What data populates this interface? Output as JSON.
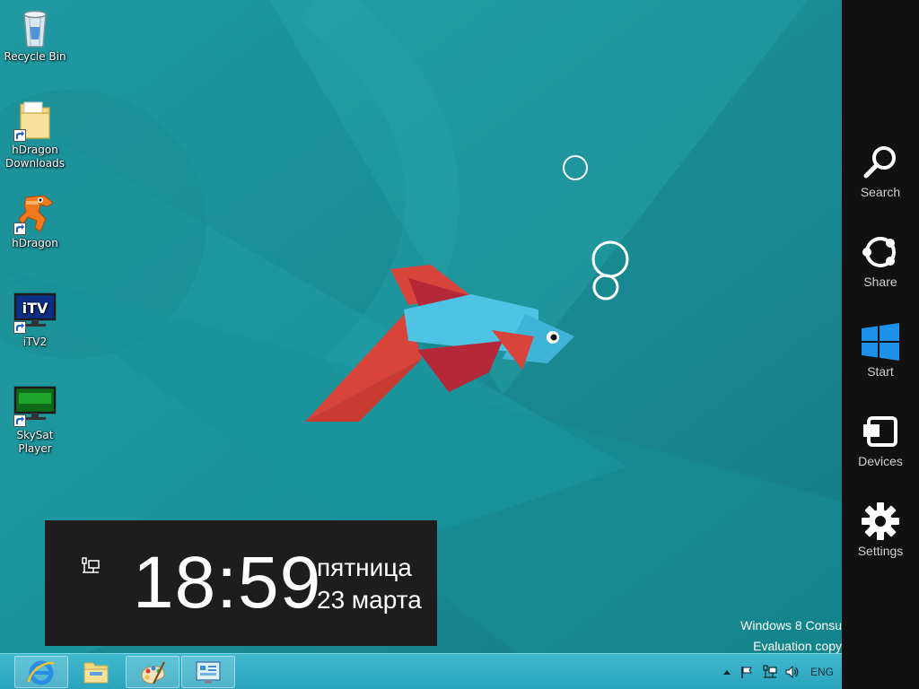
{
  "desktop": {
    "icons": [
      {
        "label": "Recycle Bin",
        "icon": "recycle-bin-icon"
      },
      {
        "label": "hDragon Downloads",
        "icon": "folder-icon"
      },
      {
        "label": "hDragon",
        "icon": "hdragon-icon"
      },
      {
        "label": "iTV2",
        "icon": "itv-icon",
        "badge": "iTV"
      },
      {
        "label": "SkySat Player",
        "icon": "skysat-icon"
      }
    ]
  },
  "charms": [
    {
      "label": "Search",
      "icon": "search-icon"
    },
    {
      "label": "Share",
      "icon": "share-icon"
    },
    {
      "label": "Start",
      "icon": "windows-logo-icon"
    },
    {
      "label": "Devices",
      "icon": "devices-icon"
    },
    {
      "label": "Settings",
      "icon": "gear-icon"
    }
  ],
  "clock": {
    "time": "18:59",
    "day": "пятница",
    "date": "23 марта"
  },
  "watermark": {
    "line1": "Windows 8 Consu",
    "line2": "Evaluation copy"
  },
  "taskbar": {
    "buttons": [
      {
        "name": "internet-explorer",
        "icon": "ie-icon"
      },
      {
        "name": "file-explorer",
        "icon": "folder-icon"
      },
      {
        "name": "paint",
        "icon": "palette-icon"
      },
      {
        "name": "control-panel",
        "icon": "control-panel-icon"
      }
    ],
    "tray": {
      "language": "ENG"
    }
  },
  "colors": {
    "wallpaper": "#1a8a92",
    "charms_bg": "#111111",
    "start_accent": "#1e90e8",
    "taskbar": "#3fb8cf"
  }
}
